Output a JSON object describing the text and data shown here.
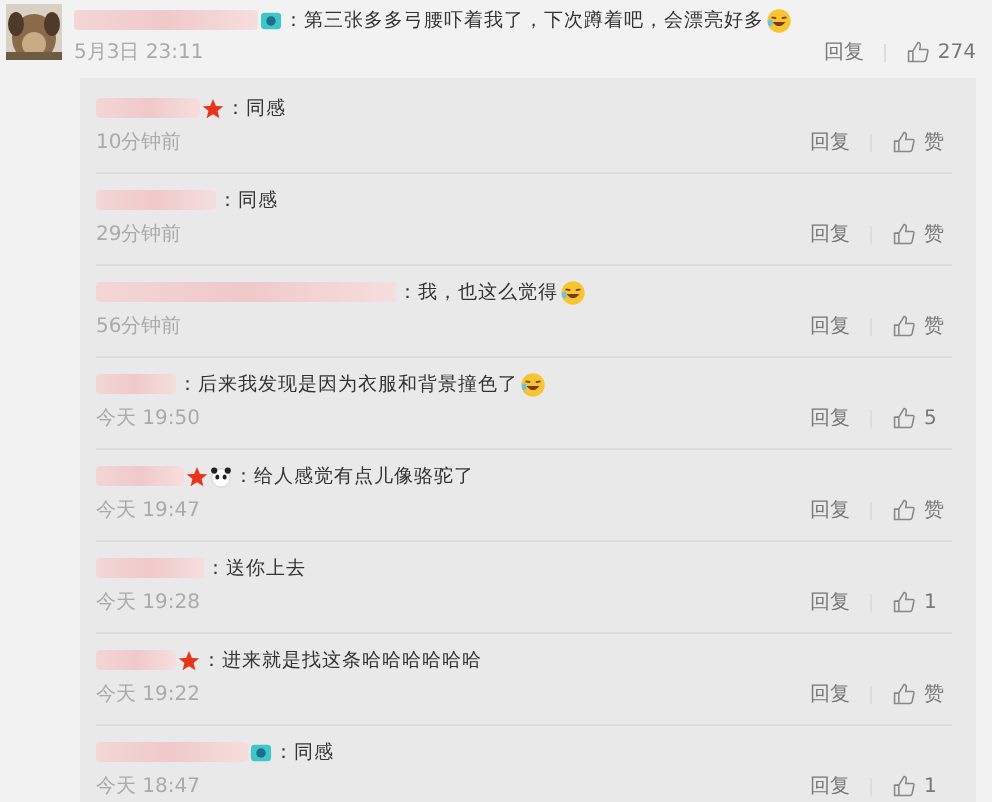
{
  "comment": {
    "badges": [
      {
        "kind": "camera"
      }
    ],
    "text": "：第三张多多弓腰吓着我了，下次蹲着吧，会漂亮好多",
    "emoji": true,
    "time": "5月3日 23:11",
    "reply": "回复",
    "like": "274"
  },
  "replies": [
    {
      "badges": [
        {
          "kind": "star"
        }
      ],
      "text": "：同感",
      "emoji": false,
      "time": "10分钟前",
      "reply": "回复",
      "like": "赞"
    },
    {
      "text": "：同感",
      "emoji": false,
      "time": "29分钟前",
      "reply": "回复",
      "like": "赞"
    },
    {
      "text": "：我，也这么觉得",
      "emoji": true,
      "time": "56分钟前",
      "reply": "回复",
      "like": "赞"
    },
    {
      "text": "：后来我发现是因为衣服和背景撞色了",
      "emoji": true,
      "time": "今天 19:50",
      "reply": "回复",
      "like": "5"
    },
    {
      "badges": [
        {
          "kind": "star"
        },
        {
          "kind": "panda"
        }
      ],
      "text": "：给人感觉有点儿像骆驼了",
      "emoji": false,
      "time": "今天 19:47",
      "reply": "回复",
      "like": "赞"
    },
    {
      "text": "：送你上去",
      "emoji": false,
      "time": "今天 19:28",
      "reply": "回复",
      "like": "1"
    },
    {
      "badges": [
        {
          "kind": "star"
        }
      ],
      "text": "：进来就是找这条哈哈哈哈哈哈",
      "emoji": false,
      "time": "今天 19:22",
      "reply": "回复",
      "like": "赞"
    },
    {
      "badges": [
        {
          "kind": "camera"
        }
      ],
      "text": "：同感",
      "emoji": false,
      "time": "今天 18:47",
      "reply": "回复",
      "like": "1"
    }
  ]
}
